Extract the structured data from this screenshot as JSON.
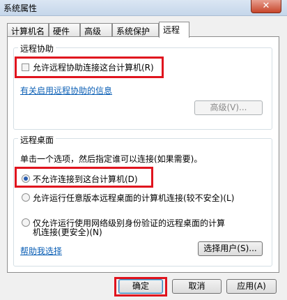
{
  "window": {
    "title": "系统属性",
    "close_glyph": "✕"
  },
  "tabs": [
    {
      "label": "计算机名",
      "active": false
    },
    {
      "label": "硬件",
      "active": false
    },
    {
      "label": "高级",
      "active": false
    },
    {
      "label": "系统保护",
      "active": false
    },
    {
      "label": "远程",
      "active": true
    }
  ],
  "remote_assistance": {
    "group_title": "远程协助",
    "allow_checkbox_label": "允许远程协助连接这台计算机(R)",
    "allow_checked": false,
    "info_link": "有关启用远程协助的信息",
    "advanced_button": "高级(V)..."
  },
  "remote_desktop": {
    "group_title": "远程桌面",
    "instruction": "单击一个选项，然后指定谁可以连接(如果需要)。",
    "options": [
      {
        "label": "不允许连接到这台计算机(D)",
        "selected": true
      },
      {
        "label": "允许运行任意版本远程桌面的计算机连接(较不安全)(L)",
        "selected": false
      },
      {
        "label_line1": "仅允许运行使用网络级别身份验证的远程桌面的计算",
        "label_line2": "机连接(更安全)(N)",
        "selected": false
      }
    ],
    "help_link": "帮助我选择",
    "select_users_button": "选择用户(S)..."
  },
  "footer": {
    "ok_button": "确定",
    "cancel_button": "取消",
    "apply_button": "应用(A)"
  },
  "colors": {
    "highlight": "#e0141e",
    "link": "#0b5fb5",
    "radio_dot": "#2a5db0"
  }
}
